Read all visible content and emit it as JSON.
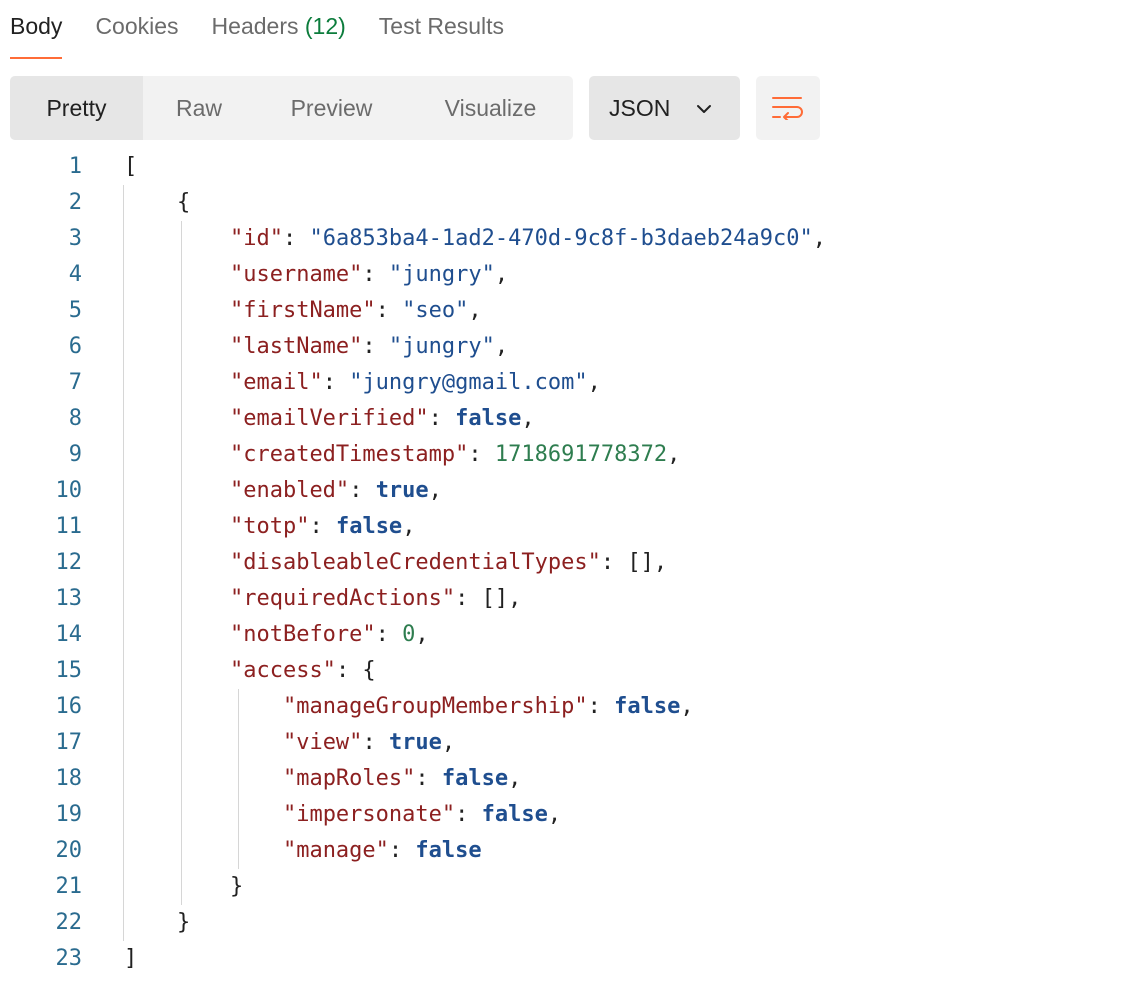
{
  "tabs": [
    {
      "label": "Body",
      "count": "",
      "active": true
    },
    {
      "label": "Cookies",
      "count": "",
      "active": false
    },
    {
      "label": "Headers",
      "count": "(12)",
      "active": false
    },
    {
      "label": "Test Results",
      "count": "",
      "active": false
    }
  ],
  "view_modes": [
    "Pretty",
    "Raw",
    "Preview",
    "Visualize"
  ],
  "active_view_mode": "Pretty",
  "format_select": {
    "value": "JSON"
  },
  "wrap_button": {
    "icon": "wrap-lines-icon"
  },
  "colors": {
    "accent": "#ff6c37",
    "key": "#8c2020",
    "string": "#1f4e8f",
    "number": "#2e7d4f",
    "boolean": "#1f4e8f",
    "line_number": "#2a6b8f"
  },
  "code_lines": [
    {
      "num": "1",
      "text": "["
    },
    {
      "num": "2",
      "text": "    {"
    },
    {
      "num": "3",
      "text": "        \"id\": \"6a853ba4-1ad2-470d-9c8f-b3daeb24a9c0\","
    },
    {
      "num": "4",
      "text": "        \"username\": \"jungry\","
    },
    {
      "num": "5",
      "text": "        \"firstName\": \"seo\","
    },
    {
      "num": "6",
      "text": "        \"lastName\": \"jungry\","
    },
    {
      "num": "7",
      "text": "        \"email\": \"jungry@gmail.com\","
    },
    {
      "num": "8",
      "text": "        \"emailVerified\": false,"
    },
    {
      "num": "9",
      "text": "        \"createdTimestamp\": 1718691778372,"
    },
    {
      "num": "10",
      "text": "        \"enabled\": true,"
    },
    {
      "num": "11",
      "text": "        \"totp\": false,"
    },
    {
      "num": "12",
      "text": "        \"disableableCredentialTypes\": [],"
    },
    {
      "num": "13",
      "text": "        \"requiredActions\": [],"
    },
    {
      "num": "14",
      "text": "        \"notBefore\": 0,"
    },
    {
      "num": "15",
      "text": "        \"access\": {"
    },
    {
      "num": "16",
      "text": "            \"manageGroupMembership\": false,"
    },
    {
      "num": "17",
      "text": "            \"view\": true,"
    },
    {
      "num": "18",
      "text": "            \"mapRoles\": false,"
    },
    {
      "num": "19",
      "text": "            \"impersonate\": false,"
    },
    {
      "num": "20",
      "text": "            \"manage\": false"
    },
    {
      "num": "21",
      "text": "        }"
    },
    {
      "num": "22",
      "text": "    }"
    },
    {
      "num": "23",
      "text": "]"
    }
  ]
}
